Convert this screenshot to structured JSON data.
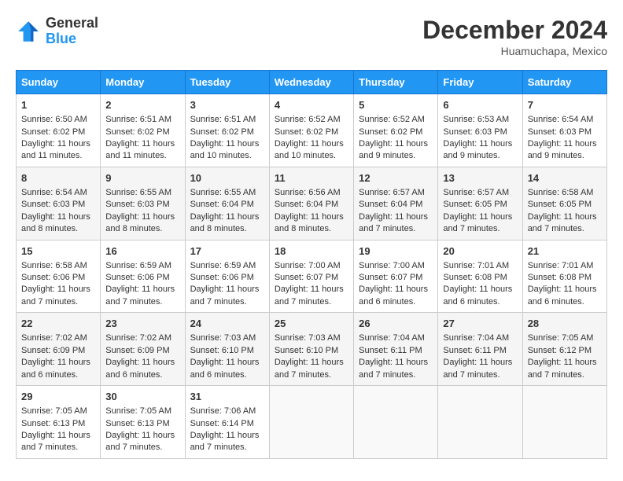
{
  "header": {
    "logo": {
      "general": "General",
      "blue": "Blue"
    },
    "title": "December 2024",
    "location": "Huamuchapa, Mexico"
  },
  "days_of_week": [
    "Sunday",
    "Monday",
    "Tuesday",
    "Wednesday",
    "Thursday",
    "Friday",
    "Saturday"
  ],
  "weeks": [
    [
      {
        "day": "1",
        "sunrise": "Sunrise: 6:50 AM",
        "sunset": "Sunset: 6:02 PM",
        "daylight": "Daylight: 11 hours and 11 minutes."
      },
      {
        "day": "2",
        "sunrise": "Sunrise: 6:51 AM",
        "sunset": "Sunset: 6:02 PM",
        "daylight": "Daylight: 11 hours and 11 minutes."
      },
      {
        "day": "3",
        "sunrise": "Sunrise: 6:51 AM",
        "sunset": "Sunset: 6:02 PM",
        "daylight": "Daylight: 11 hours and 10 minutes."
      },
      {
        "day": "4",
        "sunrise": "Sunrise: 6:52 AM",
        "sunset": "Sunset: 6:02 PM",
        "daylight": "Daylight: 11 hours and 10 minutes."
      },
      {
        "day": "5",
        "sunrise": "Sunrise: 6:52 AM",
        "sunset": "Sunset: 6:02 PM",
        "daylight": "Daylight: 11 hours and 9 minutes."
      },
      {
        "day": "6",
        "sunrise": "Sunrise: 6:53 AM",
        "sunset": "Sunset: 6:03 PM",
        "daylight": "Daylight: 11 hours and 9 minutes."
      },
      {
        "day": "7",
        "sunrise": "Sunrise: 6:54 AM",
        "sunset": "Sunset: 6:03 PM",
        "daylight": "Daylight: 11 hours and 9 minutes."
      }
    ],
    [
      {
        "day": "8",
        "sunrise": "Sunrise: 6:54 AM",
        "sunset": "Sunset: 6:03 PM",
        "daylight": "Daylight: 11 hours and 8 minutes."
      },
      {
        "day": "9",
        "sunrise": "Sunrise: 6:55 AM",
        "sunset": "Sunset: 6:03 PM",
        "daylight": "Daylight: 11 hours and 8 minutes."
      },
      {
        "day": "10",
        "sunrise": "Sunrise: 6:55 AM",
        "sunset": "Sunset: 6:04 PM",
        "daylight": "Daylight: 11 hours and 8 minutes."
      },
      {
        "day": "11",
        "sunrise": "Sunrise: 6:56 AM",
        "sunset": "Sunset: 6:04 PM",
        "daylight": "Daylight: 11 hours and 8 minutes."
      },
      {
        "day": "12",
        "sunrise": "Sunrise: 6:57 AM",
        "sunset": "Sunset: 6:04 PM",
        "daylight": "Daylight: 11 hours and 7 minutes."
      },
      {
        "day": "13",
        "sunrise": "Sunrise: 6:57 AM",
        "sunset": "Sunset: 6:05 PM",
        "daylight": "Daylight: 11 hours and 7 minutes."
      },
      {
        "day": "14",
        "sunrise": "Sunrise: 6:58 AM",
        "sunset": "Sunset: 6:05 PM",
        "daylight": "Daylight: 11 hours and 7 minutes."
      }
    ],
    [
      {
        "day": "15",
        "sunrise": "Sunrise: 6:58 AM",
        "sunset": "Sunset: 6:06 PM",
        "daylight": "Daylight: 11 hours and 7 minutes."
      },
      {
        "day": "16",
        "sunrise": "Sunrise: 6:59 AM",
        "sunset": "Sunset: 6:06 PM",
        "daylight": "Daylight: 11 hours and 7 minutes."
      },
      {
        "day": "17",
        "sunrise": "Sunrise: 6:59 AM",
        "sunset": "Sunset: 6:06 PM",
        "daylight": "Daylight: 11 hours and 7 minutes."
      },
      {
        "day": "18",
        "sunrise": "Sunrise: 7:00 AM",
        "sunset": "Sunset: 6:07 PM",
        "daylight": "Daylight: 11 hours and 7 minutes."
      },
      {
        "day": "19",
        "sunrise": "Sunrise: 7:00 AM",
        "sunset": "Sunset: 6:07 PM",
        "daylight": "Daylight: 11 hours and 6 minutes."
      },
      {
        "day": "20",
        "sunrise": "Sunrise: 7:01 AM",
        "sunset": "Sunset: 6:08 PM",
        "daylight": "Daylight: 11 hours and 6 minutes."
      },
      {
        "day": "21",
        "sunrise": "Sunrise: 7:01 AM",
        "sunset": "Sunset: 6:08 PM",
        "daylight": "Daylight: 11 hours and 6 minutes."
      }
    ],
    [
      {
        "day": "22",
        "sunrise": "Sunrise: 7:02 AM",
        "sunset": "Sunset: 6:09 PM",
        "daylight": "Daylight: 11 hours and 6 minutes."
      },
      {
        "day": "23",
        "sunrise": "Sunrise: 7:02 AM",
        "sunset": "Sunset: 6:09 PM",
        "daylight": "Daylight: 11 hours and 6 minutes."
      },
      {
        "day": "24",
        "sunrise": "Sunrise: 7:03 AM",
        "sunset": "Sunset: 6:10 PM",
        "daylight": "Daylight: 11 hours and 6 minutes."
      },
      {
        "day": "25",
        "sunrise": "Sunrise: 7:03 AM",
        "sunset": "Sunset: 6:10 PM",
        "daylight": "Daylight: 11 hours and 7 minutes."
      },
      {
        "day": "26",
        "sunrise": "Sunrise: 7:04 AM",
        "sunset": "Sunset: 6:11 PM",
        "daylight": "Daylight: 11 hours and 7 minutes."
      },
      {
        "day": "27",
        "sunrise": "Sunrise: 7:04 AM",
        "sunset": "Sunset: 6:11 PM",
        "daylight": "Daylight: 11 hours and 7 minutes."
      },
      {
        "day": "28",
        "sunrise": "Sunrise: 7:05 AM",
        "sunset": "Sunset: 6:12 PM",
        "daylight": "Daylight: 11 hours and 7 minutes."
      }
    ],
    [
      {
        "day": "29",
        "sunrise": "Sunrise: 7:05 AM",
        "sunset": "Sunset: 6:13 PM",
        "daylight": "Daylight: 11 hours and 7 minutes."
      },
      {
        "day": "30",
        "sunrise": "Sunrise: 7:05 AM",
        "sunset": "Sunset: 6:13 PM",
        "daylight": "Daylight: 11 hours and 7 minutes."
      },
      {
        "day": "31",
        "sunrise": "Sunrise: 7:06 AM",
        "sunset": "Sunset: 6:14 PM",
        "daylight": "Daylight: 11 hours and 7 minutes."
      },
      null,
      null,
      null,
      null
    ]
  ]
}
